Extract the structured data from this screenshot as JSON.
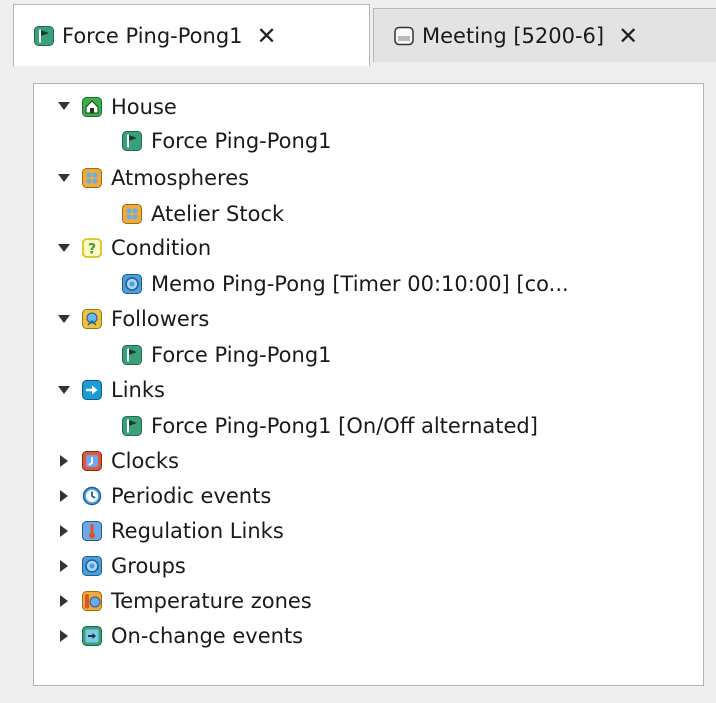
{
  "tabs": [
    {
      "label": "Force Ping-Pong1",
      "close": "✕",
      "active": true,
      "icon": "flag-icon"
    },
    {
      "label": "Meeting [5200-6]",
      "close": "✕",
      "active": false,
      "icon": "scenario-icon"
    }
  ],
  "tree": [
    {
      "label": "House",
      "icon": "house-icon",
      "level": 0,
      "expanded": true
    },
    {
      "label": "Force Ping-Pong1",
      "icon": "flag-icon",
      "level": 1
    },
    {
      "label": "Atmospheres",
      "icon": "atmosphere-icon",
      "level": 0,
      "expanded": true
    },
    {
      "label": "Atelier Stock",
      "icon": "atmosphere-icon",
      "level": 1
    },
    {
      "label": "Condition",
      "icon": "question-icon",
      "level": 0,
      "expanded": true
    },
    {
      "label": "Memo Ping-Pong [Timer 00:10:00]  [co...",
      "icon": "memo-icon",
      "level": 1
    },
    {
      "label": "Followers",
      "icon": "followers-icon",
      "level": 0,
      "expanded": true
    },
    {
      "label": "Force Ping-Pong1",
      "icon": "flag-icon",
      "level": 1
    },
    {
      "label": "Links",
      "icon": "link-arrow-icon",
      "level": 0,
      "expanded": true
    },
    {
      "label": "Force Ping-Pong1 [On/Off alternated]",
      "icon": "flag-icon",
      "level": 1
    },
    {
      "label": "Clocks",
      "icon": "clock-icon",
      "level": 0,
      "expanded": false
    },
    {
      "label": "Periodic events",
      "icon": "periodic-icon",
      "level": 0,
      "expanded": false
    },
    {
      "label": "Regulation Links",
      "icon": "thermometer-icon",
      "level": 0,
      "expanded": false
    },
    {
      "label": "Groups",
      "icon": "groups-icon",
      "level": 0,
      "expanded": false
    },
    {
      "label": "Temperature zones",
      "icon": "temperature-zone-icon",
      "level": 0,
      "expanded": false
    },
    {
      "label": "On-change events",
      "icon": "on-change-icon",
      "level": 0,
      "expanded": false
    }
  ],
  "colors": {
    "flag_bg": "#3aa07a",
    "house_bg": "#37b24d",
    "atmosphere_bg": "#f2a93b",
    "question": "#e0c000",
    "memo_bg": "#4a9fe0",
    "links_bg": "#1c9bd6",
    "clock_bg": "#e0583a",
    "thermo_bg": "#d9542b"
  }
}
